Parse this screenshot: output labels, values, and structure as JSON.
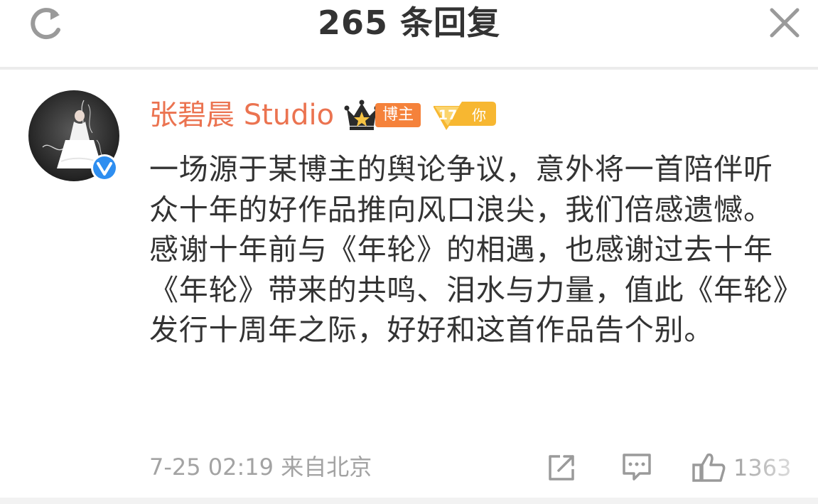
{
  "header": {
    "title": "265 条回复",
    "refresh_icon": "refresh-icon",
    "close_icon": "close-icon"
  },
  "post": {
    "author": "张碧晨 Studio",
    "badges": {
      "vip_icon": "crown-icon",
      "blogger_label": "博主",
      "level_number": "17",
      "level_suffix": "你"
    },
    "verified_icon": "verified-icon",
    "text": "一场源于某博主的舆论争议，意外将一首陪伴听众十年的好作品推向风口浪尖，我们倍感遗憾。感谢十年前与《年轮》的相遇，也感谢过去十年《年轮》带来的共鸣、泪水与力量，值此《年轮》发行十周年之际，好好和这首作品告个别。",
    "meta": "7-25 02:19 来自北京",
    "actions": {
      "repost_icon": "repost-icon",
      "comment_icon": "comment-icon",
      "like_icon": "thumbs-up-icon",
      "like_count": "1363"
    }
  },
  "colors": {
    "accent": "#eb7350",
    "blogger_badge": "#f5823b",
    "level_badge": "#f7b731",
    "verified": "#2e8ef0",
    "text": "#333333",
    "muted": "#a3a3a3"
  }
}
